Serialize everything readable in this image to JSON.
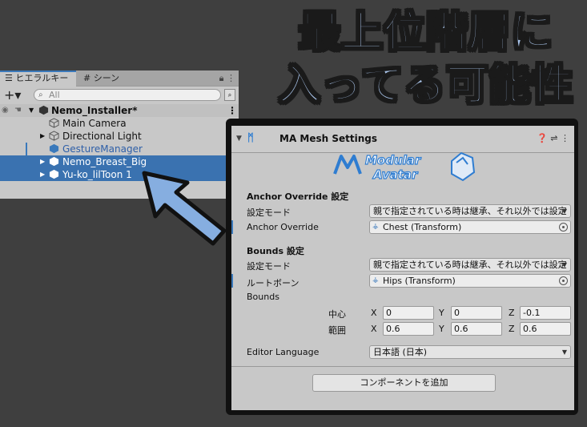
{
  "annotation": {
    "line1": "最上位階層に",
    "line2": "入ってる可能性"
  },
  "hierarchy": {
    "tab_label": "ヒエラルキー",
    "scene_tab_label": "シーン",
    "search_placeholder": "All",
    "root": "Nemo_Installer*",
    "items": [
      {
        "label": "Main Camera",
        "selected": false,
        "expandable": false
      },
      {
        "label": "Directional Light",
        "selected": false,
        "expandable": true
      },
      {
        "label": "GestureManager",
        "selected": false,
        "expandable": false
      },
      {
        "label": "Nemo_Breast_Big",
        "selected": true,
        "expandable": true
      },
      {
        "label": "Yu-ko_lilToon 1",
        "selected": true,
        "expandable": true
      }
    ]
  },
  "inspector": {
    "component_title": "MA Mesh Settings",
    "logo_line1": "Modular",
    "logo_line2": "Avatar",
    "anchor_section": "Anchor Override 設定",
    "anchor_mode_label": "設定モード",
    "anchor_mode_value": "親で指定されている時は継承、それ以外では設定",
    "anchor_override_label": "Anchor Override",
    "anchor_override_value": "Chest (Transform)",
    "bounds_section": "Bounds 設定",
    "bounds_mode_label": "設定モード",
    "bounds_mode_value": "親で指定されている時は継承、それ以外では設定",
    "root_bone_label": "ルートボーン",
    "root_bone_value": "Hips (Transform)",
    "bounds_label": "Bounds",
    "center_label": "中心",
    "extent_label": "範囲",
    "center": {
      "x": "0",
      "y": "0",
      "z": "-0.1"
    },
    "extent": {
      "x": "0.6",
      "y": "0.6",
      "z": "0.6"
    },
    "axis_x": "X",
    "axis_y": "Y",
    "axis_z": "Z",
    "editor_language_label": "Editor Language",
    "editor_language_value": "日本語 (日本)",
    "add_component_label": "コンポーネントを追加"
  }
}
